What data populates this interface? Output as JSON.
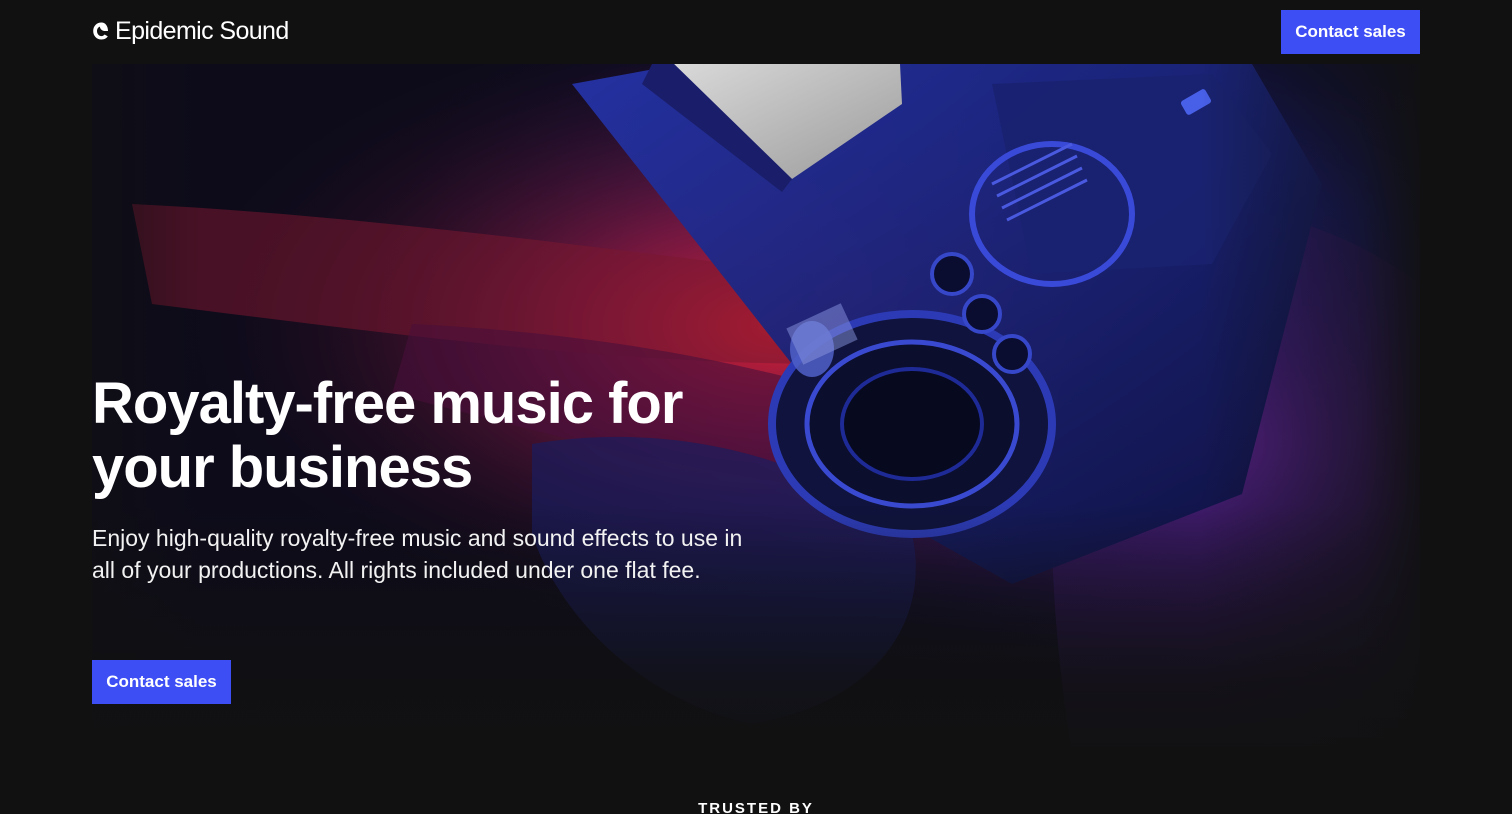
{
  "brand": {
    "logo_text": "Epidemic Sound",
    "logo_icon": "epidemic-sound-mark-icon"
  },
  "header": {
    "cta_label": "Contact sales"
  },
  "hero": {
    "title": "Royalty-free music for your business",
    "subtitle": "Enjoy high-quality royalty-free music and sound effects to use in all of your productions. All rights included under one flat fee.",
    "cta_label": "Contact sales",
    "image_description_icon": "camera-photo"
  },
  "trusted": {
    "label": "TRUSTED BY"
  },
  "colors": {
    "background": "#111112",
    "accent": "#3d4ef5",
    "text": "#ffffff"
  }
}
